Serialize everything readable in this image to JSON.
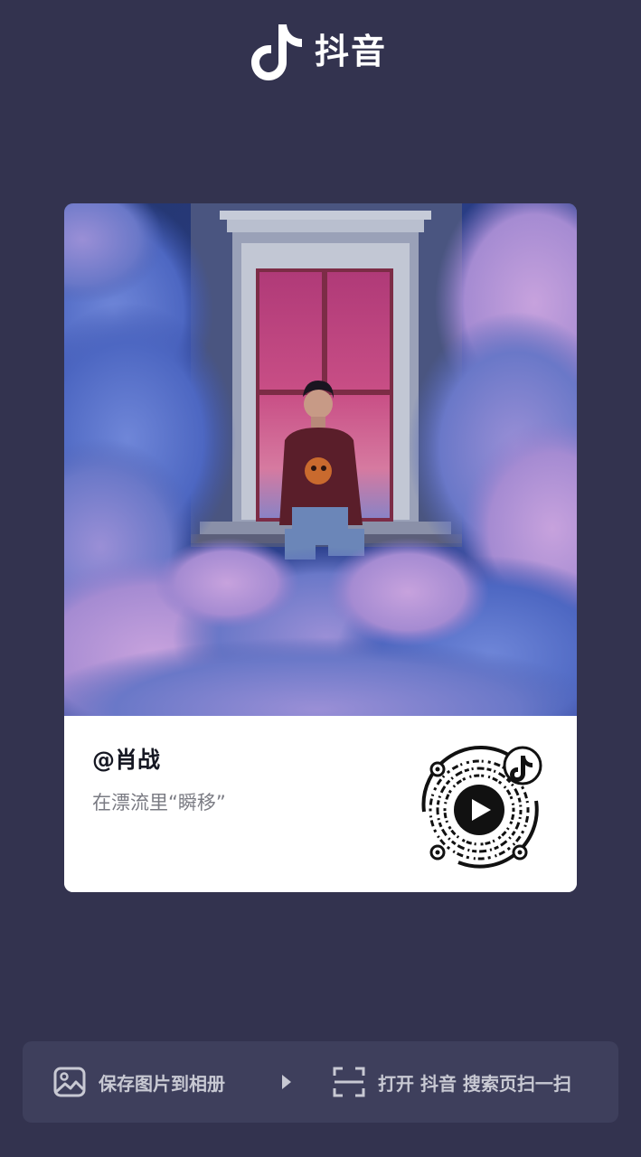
{
  "header": {
    "brand_icon": "douyin-note-icon",
    "brand_name": "抖音"
  },
  "card": {
    "cover_image": "man-sitting-in-window-among-clouds",
    "username": "@肖战",
    "caption": "在漂流里“瞬移”",
    "qr_icon": "douyin-qr-code",
    "qr_center_icon": "play-icon"
  },
  "actions": {
    "save_label": "保存图片到相册",
    "save_icon": "image-icon",
    "step_icon": "triangle-right-icon",
    "scan_label": "打开 抖音 搜索页扫一扫",
    "scan_icon": "scan-frame-icon"
  },
  "colors": {
    "background": "#33334f",
    "bar": "#3e3f5c",
    "card": "#ffffff",
    "username": "#161823",
    "caption": "#7a7b83"
  }
}
